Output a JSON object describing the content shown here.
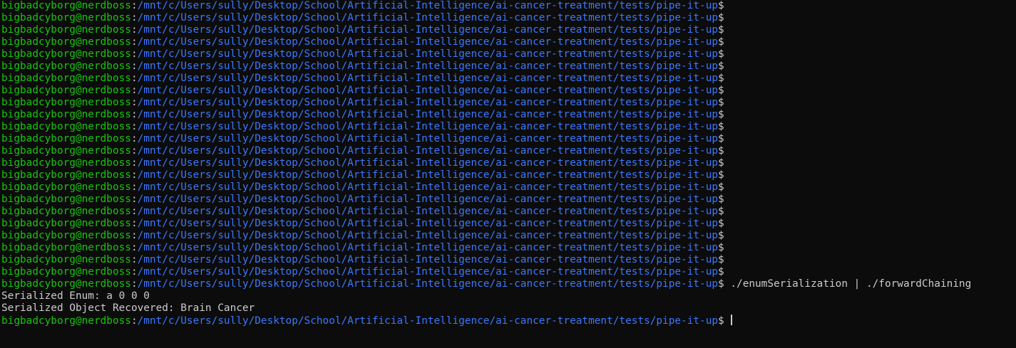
{
  "terminal": {
    "colors": {
      "background": "#0c0c0c",
      "user_host": "#16c60c",
      "path": "#3b78ff",
      "text": "#cccccc"
    },
    "lines": [
      {
        "type": "prompt",
        "user_host": "bigbadcyborg@nerdboss",
        "sep": ":",
        "path": "/mnt/c/Users/sully/Desktop/School/Artificial-Intelligence/ai-cancer-treatment/tests/pipe-it-up",
        "symbol": "$",
        "command": ""
      },
      {
        "type": "prompt",
        "user_host": "bigbadcyborg@nerdboss",
        "sep": ":",
        "path": "/mnt/c/Users/sully/Desktop/School/Artificial-Intelligence/ai-cancer-treatment/tests/pipe-it-up",
        "symbol": "$",
        "command": ""
      },
      {
        "type": "prompt",
        "user_host": "bigbadcyborg@nerdboss",
        "sep": ":",
        "path": "/mnt/c/Users/sully/Desktop/School/Artificial-Intelligence/ai-cancer-treatment/tests/pipe-it-up",
        "symbol": "$",
        "command": ""
      },
      {
        "type": "prompt",
        "user_host": "bigbadcyborg@nerdboss",
        "sep": ":",
        "path": "/mnt/c/Users/sully/Desktop/School/Artificial-Intelligence/ai-cancer-treatment/tests/pipe-it-up",
        "symbol": "$",
        "command": ""
      },
      {
        "type": "prompt",
        "user_host": "bigbadcyborg@nerdboss",
        "sep": ":",
        "path": "/mnt/c/Users/sully/Desktop/School/Artificial-Intelligence/ai-cancer-treatment/tests/pipe-it-up",
        "symbol": "$",
        "command": ""
      },
      {
        "type": "prompt",
        "user_host": "bigbadcyborg@nerdboss",
        "sep": ":",
        "path": "/mnt/c/Users/sully/Desktop/School/Artificial-Intelligence/ai-cancer-treatment/tests/pipe-it-up",
        "symbol": "$",
        "command": ""
      },
      {
        "type": "prompt",
        "user_host": "bigbadcyborg@nerdboss",
        "sep": ":",
        "path": "/mnt/c/Users/sully/Desktop/School/Artificial-Intelligence/ai-cancer-treatment/tests/pipe-it-up",
        "symbol": "$",
        "command": ""
      },
      {
        "type": "prompt",
        "user_host": "bigbadcyborg@nerdboss",
        "sep": ":",
        "path": "/mnt/c/Users/sully/Desktop/School/Artificial-Intelligence/ai-cancer-treatment/tests/pipe-it-up",
        "symbol": "$",
        "command": ""
      },
      {
        "type": "prompt",
        "user_host": "bigbadcyborg@nerdboss",
        "sep": ":",
        "path": "/mnt/c/Users/sully/Desktop/School/Artificial-Intelligence/ai-cancer-treatment/tests/pipe-it-up",
        "symbol": "$",
        "command": ""
      },
      {
        "type": "prompt",
        "user_host": "bigbadcyborg@nerdboss",
        "sep": ":",
        "path": "/mnt/c/Users/sully/Desktop/School/Artificial-Intelligence/ai-cancer-treatment/tests/pipe-it-up",
        "symbol": "$",
        "command": ""
      },
      {
        "type": "prompt",
        "user_host": "bigbadcyborg@nerdboss",
        "sep": ":",
        "path": "/mnt/c/Users/sully/Desktop/School/Artificial-Intelligence/ai-cancer-treatment/tests/pipe-it-up",
        "symbol": "$",
        "command": ""
      },
      {
        "type": "prompt",
        "user_host": "bigbadcyborg@nerdboss",
        "sep": ":",
        "path": "/mnt/c/Users/sully/Desktop/School/Artificial-Intelligence/ai-cancer-treatment/tests/pipe-it-up",
        "symbol": "$",
        "command": ""
      },
      {
        "type": "prompt",
        "user_host": "bigbadcyborg@nerdboss",
        "sep": ":",
        "path": "/mnt/c/Users/sully/Desktop/School/Artificial-Intelligence/ai-cancer-treatment/tests/pipe-it-up",
        "symbol": "$",
        "command": ""
      },
      {
        "type": "prompt",
        "user_host": "bigbadcyborg@nerdboss",
        "sep": ":",
        "path": "/mnt/c/Users/sully/Desktop/School/Artificial-Intelligence/ai-cancer-treatment/tests/pipe-it-up",
        "symbol": "$",
        "command": ""
      },
      {
        "type": "prompt",
        "user_host": "bigbadcyborg@nerdboss",
        "sep": ":",
        "path": "/mnt/c/Users/sully/Desktop/School/Artificial-Intelligence/ai-cancer-treatment/tests/pipe-it-up",
        "symbol": "$",
        "command": ""
      },
      {
        "type": "prompt",
        "user_host": "bigbadcyborg@nerdboss",
        "sep": ":",
        "path": "/mnt/c/Users/sully/Desktop/School/Artificial-Intelligence/ai-cancer-treatment/tests/pipe-it-up",
        "symbol": "$",
        "command": ""
      },
      {
        "type": "prompt",
        "user_host": "bigbadcyborg@nerdboss",
        "sep": ":",
        "path": "/mnt/c/Users/sully/Desktop/School/Artificial-Intelligence/ai-cancer-treatment/tests/pipe-it-up",
        "symbol": "$",
        "command": ""
      },
      {
        "type": "prompt",
        "user_host": "bigbadcyborg@nerdboss",
        "sep": ":",
        "path": "/mnt/c/Users/sully/Desktop/School/Artificial-Intelligence/ai-cancer-treatment/tests/pipe-it-up",
        "symbol": "$",
        "command": ""
      },
      {
        "type": "prompt",
        "user_host": "bigbadcyborg@nerdboss",
        "sep": ":",
        "path": "/mnt/c/Users/sully/Desktop/School/Artificial-Intelligence/ai-cancer-treatment/tests/pipe-it-up",
        "symbol": "$",
        "command": ""
      },
      {
        "type": "prompt",
        "user_host": "bigbadcyborg@nerdboss",
        "sep": ":",
        "path": "/mnt/c/Users/sully/Desktop/School/Artificial-Intelligence/ai-cancer-treatment/tests/pipe-it-up",
        "symbol": "$",
        "command": ""
      },
      {
        "type": "prompt",
        "user_host": "bigbadcyborg@nerdboss",
        "sep": ":",
        "path": "/mnt/c/Users/sully/Desktop/School/Artificial-Intelligence/ai-cancer-treatment/tests/pipe-it-up",
        "symbol": "$",
        "command": ""
      },
      {
        "type": "prompt",
        "user_host": "bigbadcyborg@nerdboss",
        "sep": ":",
        "path": "/mnt/c/Users/sully/Desktop/School/Artificial-Intelligence/ai-cancer-treatment/tests/pipe-it-up",
        "symbol": "$",
        "command": ""
      },
      {
        "type": "prompt",
        "user_host": "bigbadcyborg@nerdboss",
        "sep": ":",
        "path": "/mnt/c/Users/sully/Desktop/School/Artificial-Intelligence/ai-cancer-treatment/tests/pipe-it-up",
        "symbol": "$",
        "command": ""
      },
      {
        "type": "prompt",
        "user_host": "bigbadcyborg@nerdboss",
        "sep": ":",
        "path": "/mnt/c/Users/sully/Desktop/School/Artificial-Intelligence/ai-cancer-treatment/tests/pipe-it-up",
        "symbol": "$",
        "command": " ./enumSerialization | ./forwardChaining"
      },
      {
        "type": "output",
        "text": "Serialized Enum: a 0 0 0"
      },
      {
        "type": "output",
        "text": "Serialized Object Recovered: Brain Cancer"
      },
      {
        "type": "prompt",
        "user_host": "bigbadcyborg@nerdboss",
        "sep": ":",
        "path": "/mnt/c/Users/sully/Desktop/School/Artificial-Intelligence/ai-cancer-treatment/tests/pipe-it-up",
        "symbol": "$",
        "command": " ",
        "cursor": true
      }
    ]
  }
}
